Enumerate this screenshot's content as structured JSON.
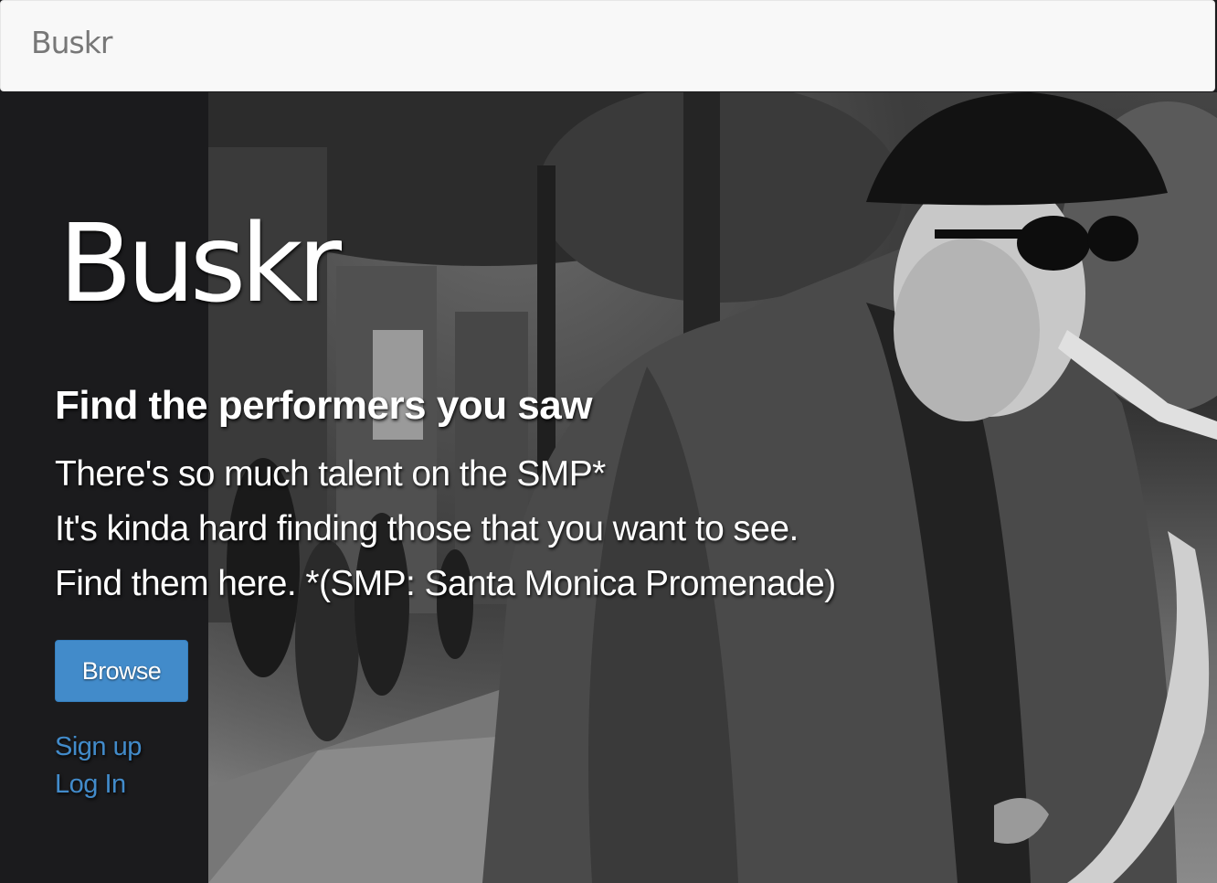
{
  "navbar": {
    "brand": "Buskr"
  },
  "hero": {
    "title": "Buskr",
    "subtitle": "Find the performers you saw",
    "lines": [
      "There's so much talent on the SMP*",
      "It's kinda hard finding those that you want to see.",
      "Find them here. *(SMP: Santa Monica Promenade)"
    ],
    "browse_label": "Browse",
    "signup_label": "Sign up",
    "login_label": "Log In"
  },
  "colors": {
    "navbar_bg": "#f8f8f8",
    "brand_text": "#777777",
    "primary_button": "#428bca",
    "link": "#428bca",
    "left_panel": "#1b1b1d"
  }
}
